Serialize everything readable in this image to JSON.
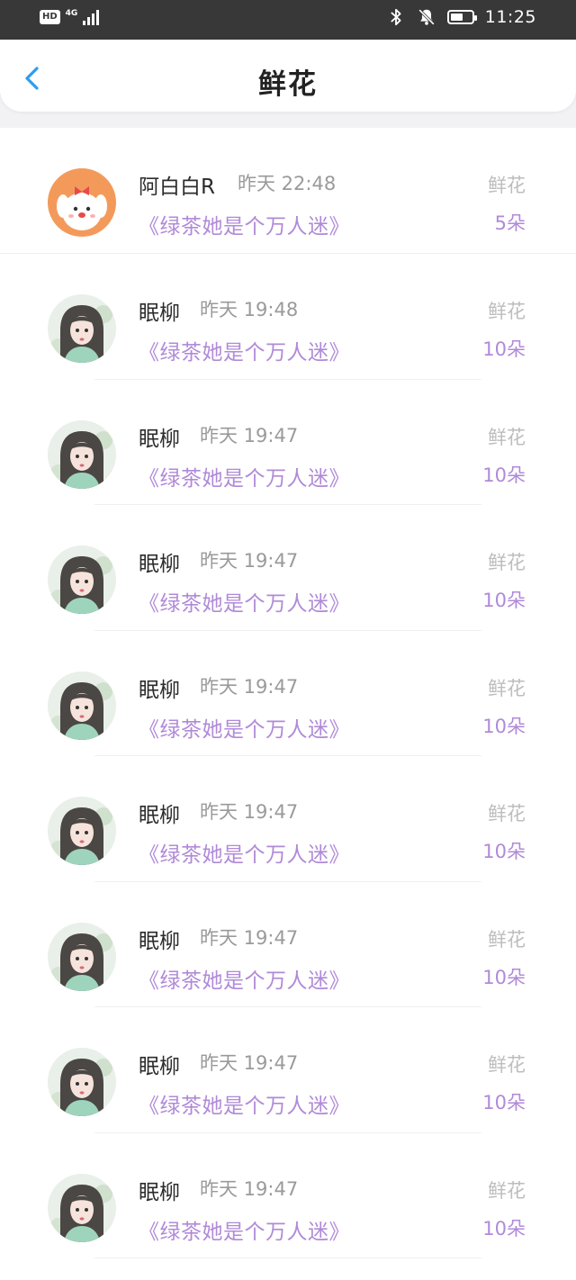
{
  "status_bar": {
    "hd_label": "HD",
    "network_label": "4G",
    "time": "11:25",
    "battery_level": 0.6,
    "icons": [
      "signal-icon",
      "bluetooth-icon",
      "mute-notification-icon",
      "battery-icon"
    ]
  },
  "header": {
    "title": "鲜花",
    "back_icon": "chevron-left-icon",
    "accent_color": "#2d9cf0"
  },
  "colors": {
    "purple": "#b08ad8",
    "secondary_text": "#9a9a9a",
    "label_text": "#bdbdbd"
  },
  "records": [
    {
      "name": "阿白白R",
      "time": "昨天 22:48",
      "book": "《绿茶她是个万人迷》",
      "gift_label": "鲜花",
      "count": "5朵",
      "avatar": "white-dog-avatar"
    },
    {
      "name": "眠柳",
      "time": "昨天 19:48",
      "book": "《绿茶她是个万人迷》",
      "gift_label": "鲜花",
      "count": "10朵",
      "avatar": "girl-avatar"
    },
    {
      "name": "眠柳",
      "time": "昨天 19:47",
      "book": "《绿茶她是个万人迷》",
      "gift_label": "鲜花",
      "count": "10朵",
      "avatar": "girl-avatar"
    },
    {
      "name": "眠柳",
      "time": "昨天 19:47",
      "book": "《绿茶她是个万人迷》",
      "gift_label": "鲜花",
      "count": "10朵",
      "avatar": "girl-avatar"
    },
    {
      "name": "眠柳",
      "time": "昨天 19:47",
      "book": "《绿茶她是个万人迷》",
      "gift_label": "鲜花",
      "count": "10朵",
      "avatar": "girl-avatar"
    },
    {
      "name": "眠柳",
      "time": "昨天 19:47",
      "book": "《绿茶她是个万人迷》",
      "gift_label": "鲜花",
      "count": "10朵",
      "avatar": "girl-avatar"
    },
    {
      "name": "眠柳",
      "time": "昨天 19:47",
      "book": "《绿茶她是个万人迷》",
      "gift_label": "鲜花",
      "count": "10朵",
      "avatar": "girl-avatar"
    },
    {
      "name": "眠柳",
      "time": "昨天 19:47",
      "book": "《绿茶她是个万人迷》",
      "gift_label": "鲜花",
      "count": "10朵",
      "avatar": "girl-avatar"
    },
    {
      "name": "眠柳",
      "time": "昨天 19:47",
      "book": "《绿茶她是个万人迷》",
      "gift_label": "鲜花",
      "count": "10朵",
      "avatar": "girl-avatar"
    }
  ]
}
